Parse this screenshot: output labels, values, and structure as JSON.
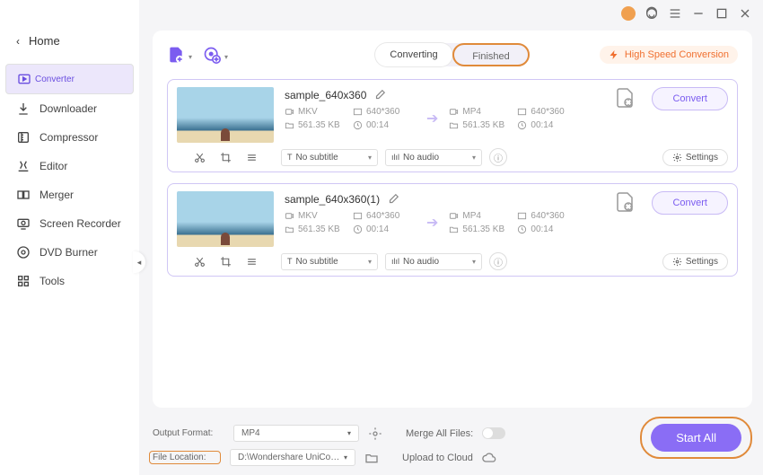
{
  "header": {
    "home": "Home"
  },
  "sidebar": {
    "items": [
      {
        "label": "Converter"
      },
      {
        "label": "Downloader"
      },
      {
        "label": "Compressor"
      },
      {
        "label": "Editor"
      },
      {
        "label": "Merger"
      },
      {
        "label": "Screen Recorder"
      },
      {
        "label": "DVD Burner"
      },
      {
        "label": "Tools"
      }
    ]
  },
  "tabs": {
    "converting": "Converting",
    "finished": "Finished"
  },
  "highspeed": "High Speed Conversion",
  "files": [
    {
      "name": "sample_640x360",
      "src_format": "MKV",
      "src_res": "640*360",
      "src_size": "561.35 KB",
      "src_dur": "00:14",
      "dst_format": "MP4",
      "dst_res": "640*360",
      "dst_size": "561.35 KB",
      "dst_dur": "00:14",
      "subtitle": "No subtitle",
      "audio": "No audio",
      "convert": "Convert",
      "settings": "Settings"
    },
    {
      "name": "sample_640x360(1)",
      "src_format": "MKV",
      "src_res": "640*360",
      "src_size": "561.35 KB",
      "src_dur": "00:14",
      "dst_format": "MP4",
      "dst_res": "640*360",
      "dst_size": "561.35 KB",
      "dst_dur": "00:14",
      "subtitle": "No subtitle",
      "audio": "No audio",
      "convert": "Convert",
      "settings": "Settings"
    }
  ],
  "footer": {
    "output_format_label": "Output Format:",
    "output_format": "MP4",
    "file_location_label": "File Location:",
    "file_location": "D:\\Wondershare UniConverter 1",
    "merge_label": "Merge All Files:",
    "upload_label": "Upload to Cloud",
    "start_all": "Start All"
  }
}
